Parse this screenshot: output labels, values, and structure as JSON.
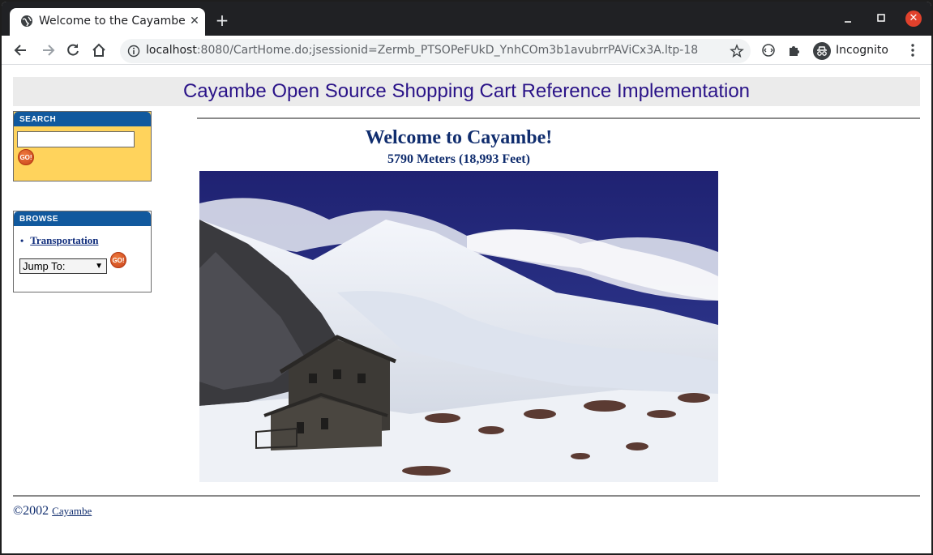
{
  "browser": {
    "tab_title": "Welcome to the Cayambe",
    "tab_close": "✕",
    "new_tab": "+",
    "win_close": "✕",
    "url_host": "localhost",
    "url_rest": ":8080/CartHome.do;jsessionid=Zermb_PTSOPeFUkD_YnhCOm3b1avubrrPAViCx3A.ltp-18",
    "profile_label": "Incognito",
    "icons": [
      "globe-icon",
      "back-icon",
      "forward-icon",
      "reload-icon",
      "home-icon",
      "info-icon",
      "star-icon",
      "extension-icon",
      "puzzle-icon",
      "incognito-icon",
      "menu-icon",
      "minimize-icon",
      "maximize-icon",
      "close-icon"
    ]
  },
  "page": {
    "banner": "Cayambe Open Source Shopping Cart Reference Implementation",
    "search": {
      "heading": "SEARCH",
      "value": "",
      "go_label": "GO!"
    },
    "browse": {
      "heading": "BROWSE",
      "items": [
        {
          "bullet": "•",
          "label": "Transportation"
        }
      ],
      "jump_label": "Jump To:",
      "go_label": "GO!"
    },
    "welcome": "Welcome to Cayambe!",
    "altitude": "5790 Meters (18,993 Feet)",
    "footer": {
      "copyright": "©2002",
      "link": "Cayambe"
    }
  },
  "colors": {
    "banner_text": "#2a1388",
    "box_header": "#11599e",
    "search_bg": "#ffd35c",
    "heading_text": "#102d6e"
  }
}
